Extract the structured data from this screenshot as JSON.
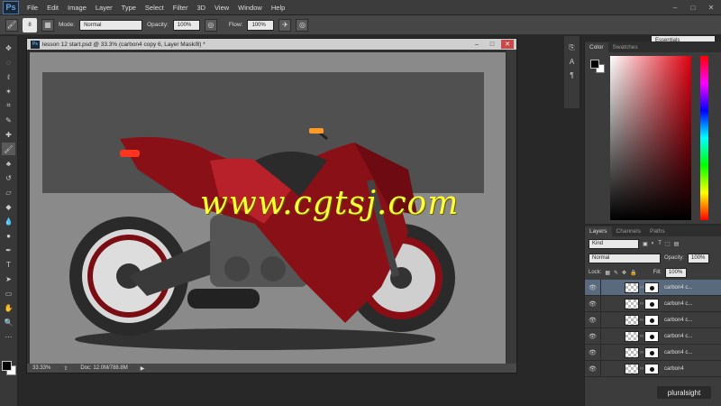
{
  "menubar": {
    "logo": "Ps",
    "items": [
      "File",
      "Edit",
      "Image",
      "Layer",
      "Type",
      "Select",
      "Filter",
      "3D",
      "View",
      "Window",
      "Help"
    ],
    "controls": [
      "–",
      "□",
      "✕"
    ]
  },
  "options": {
    "brush_size": "8",
    "mode_label": "Mode:",
    "mode_value": "Normal",
    "opacity_label": "Opacity:",
    "opacity_value": "100%",
    "flow_label": "Flow:",
    "flow_value": "100%",
    "workspace": "Essentials"
  },
  "document": {
    "title": "lesson 12 start.psd @ 33.3% (carbon4 copy 6, Layer Mask/8) *",
    "zoom": "33.33%",
    "doc_size": "Doc: 12.0M/788.8M",
    "controls": [
      "–",
      "□",
      "✕"
    ]
  },
  "watermark": "www.cgtsj.com",
  "color_panel": {
    "tabs": [
      "Color",
      "Swatches"
    ]
  },
  "layers_panel": {
    "tabs": [
      "Layers",
      "Channels",
      "Paths"
    ],
    "kind": "Kind",
    "blend_mode": "Normal",
    "opacity_label": "Opacity:",
    "opacity_value": "100%",
    "lock_label": "Lock:",
    "fill_label": "Fill:",
    "fill_value": "100%",
    "layers": [
      {
        "name": "carbon4 c..."
      },
      {
        "name": "carbon4 c..."
      },
      {
        "name": "carbon4 c..."
      },
      {
        "name": "carbon4 c..."
      },
      {
        "name": "carbon4 c..."
      },
      {
        "name": "carbon4"
      }
    ]
  },
  "branding": "pluralsight"
}
